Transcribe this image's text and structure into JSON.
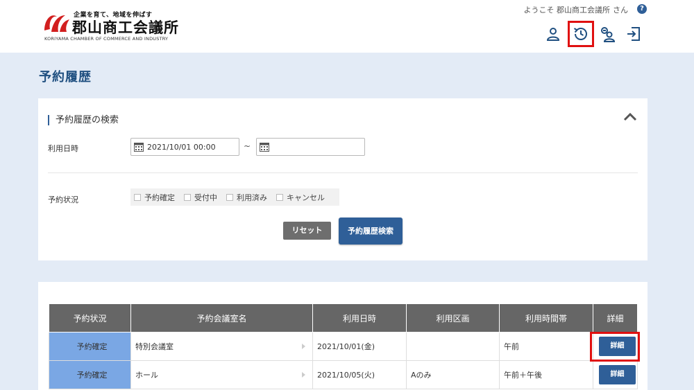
{
  "header": {
    "logo": {
      "tagline": "企業を育て、地域を伸ばす",
      "name": "郡山商工会議所",
      "english": "KORIYAMA CHAMBER OF COMMERCE AND INDUSTRY"
    },
    "welcome_prefix": "ようこそ",
    "user_name": "郡山商工会議所",
    "welcome_suffix": "さん",
    "help_label": "?"
  },
  "page_title": "予約履歴",
  "search": {
    "heading": "予約履歴の検索",
    "date_label": "利用日時",
    "date_from_value": "2021/10/01 00:00",
    "date_to_value": "",
    "tilde": "~",
    "status_label": "予約状況",
    "status_options": [
      "予約確定",
      "受付中",
      "利用済み",
      "キャンセル"
    ],
    "reset_label": "リセット",
    "search_label": "予約履歴検索"
  },
  "results": {
    "columns": [
      "予約状況",
      "予約会議室名",
      "利用日時",
      "利用区画",
      "利用時間帯",
      "詳細"
    ],
    "rows": [
      {
        "status": "予約確定",
        "room": "特別会議室",
        "date": "2021/10/01(金)",
        "section": "",
        "time": "午前",
        "detail": "詳細"
      },
      {
        "status": "予約確定",
        "room": "ホール",
        "date": "2021/10/05(火)",
        "section": "Aのみ",
        "time": "午前＋午後",
        "detail": "詳細"
      }
    ]
  },
  "colors": {
    "accent": "#2f5f98",
    "title": "#1f4f80",
    "status_bg": "#7aa7e4",
    "highlight": "#e01010",
    "background": "#e3ebf6"
  },
  "icons": [
    "user-icon",
    "history-icon",
    "group-icon",
    "logout-icon",
    "calendar-icon",
    "chevron-up-icon",
    "help-icon"
  ]
}
